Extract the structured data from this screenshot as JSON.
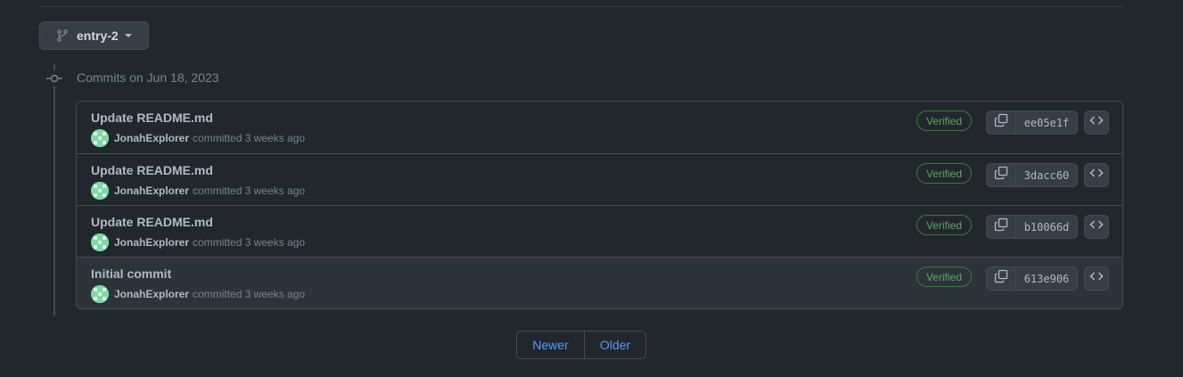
{
  "branch": {
    "name": "entry-2"
  },
  "timeline": {
    "date_label": "Commits on Jun 18, 2023"
  },
  "commits": [
    {
      "title": "Update README.md",
      "author": "JonahExplorer",
      "meta": "committed 3 weeks ago",
      "badge": "Verified",
      "sha": "ee05e1f"
    },
    {
      "title": "Update README.md",
      "author": "JonahExplorer",
      "meta": "committed 3 weeks ago",
      "badge": "Verified",
      "sha": "3dacc60"
    },
    {
      "title": "Update README.md",
      "author": "JonahExplorer",
      "meta": "committed 3 weeks ago",
      "badge": "Verified",
      "sha": "b10066d"
    },
    {
      "title": "Initial commit",
      "author": "JonahExplorer",
      "meta": "committed 3 weeks ago",
      "badge": "Verified",
      "sha": "613e906"
    }
  ],
  "pagination": {
    "newer_label": "Newer",
    "older_label": "Older"
  },
  "icons": {
    "branch": "git-branch-icon",
    "caret": "caret-down-icon",
    "commit": "git-commit-icon",
    "copy": "copy-icon",
    "browse": "code-icon"
  },
  "colors": {
    "background": "#22272e",
    "highlight_row": "#2d333b",
    "verified": "#57ab5a",
    "link": "#539bf5",
    "avatar": "#7fd8a5"
  }
}
